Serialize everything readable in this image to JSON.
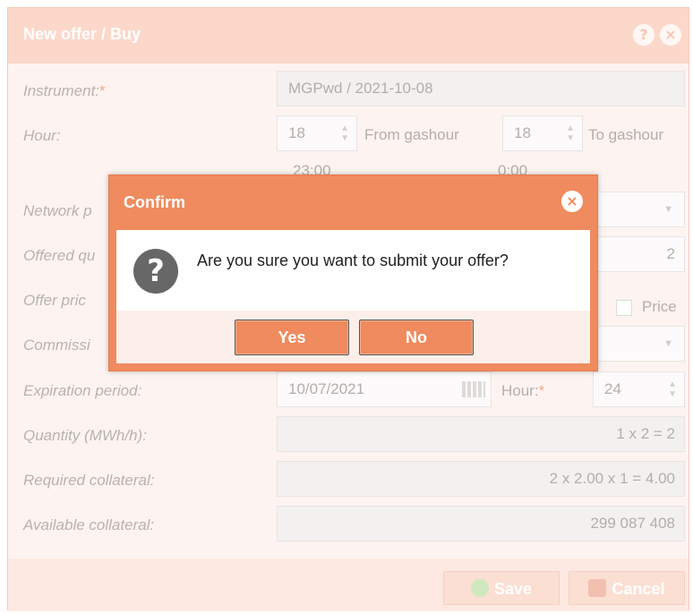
{
  "window": {
    "title": "New offer / Buy",
    "help_icon": "?",
    "close_icon": "×"
  },
  "form": {
    "instrument": {
      "label": "Instrument:",
      "required": "*",
      "value": "MGPwd / 2021-10-08"
    },
    "hour": {
      "label": "Hour:",
      "from_value": "18",
      "from_label": "From gashour",
      "from_time": "23:00",
      "to_value": "18",
      "to_label": "To gashour",
      "to_time": "0:00"
    },
    "network_point": {
      "label": "Network p"
    },
    "offered_quantity": {
      "label": "Offered qu",
      "value": "2"
    },
    "offer_price": {
      "label": "Offer pric",
      "price_checkbox_label": "Price"
    },
    "commission": {
      "label": "Commissi"
    },
    "expiration": {
      "label": "Expiration period:",
      "date": "10/07/2021",
      "hour_label": "Hour:",
      "hour_required": "*",
      "hour_value": "24"
    },
    "quantity": {
      "label": "Quantity (MWh/h):",
      "value": "1 x 2 = 2"
    },
    "required_collateral": {
      "label": "Required collateral:",
      "value": "2 x 2.00 x 1 = 4.00"
    },
    "available_collateral": {
      "label": "Available collateral:",
      "value": "299 087 408"
    }
  },
  "footer": {
    "save_label": "Save",
    "cancel_label": "Cancel"
  },
  "dialog": {
    "title": "Confirm",
    "message": "Are you sure you want to submit your offer?",
    "question_icon": "?",
    "close_icon": "×",
    "yes_label": "Yes",
    "no_label": "No"
  },
  "colors": {
    "accent": "#ef8b5e",
    "title_bar_faded": "#fbd8ca",
    "form_bg": "#fdf4f1"
  }
}
